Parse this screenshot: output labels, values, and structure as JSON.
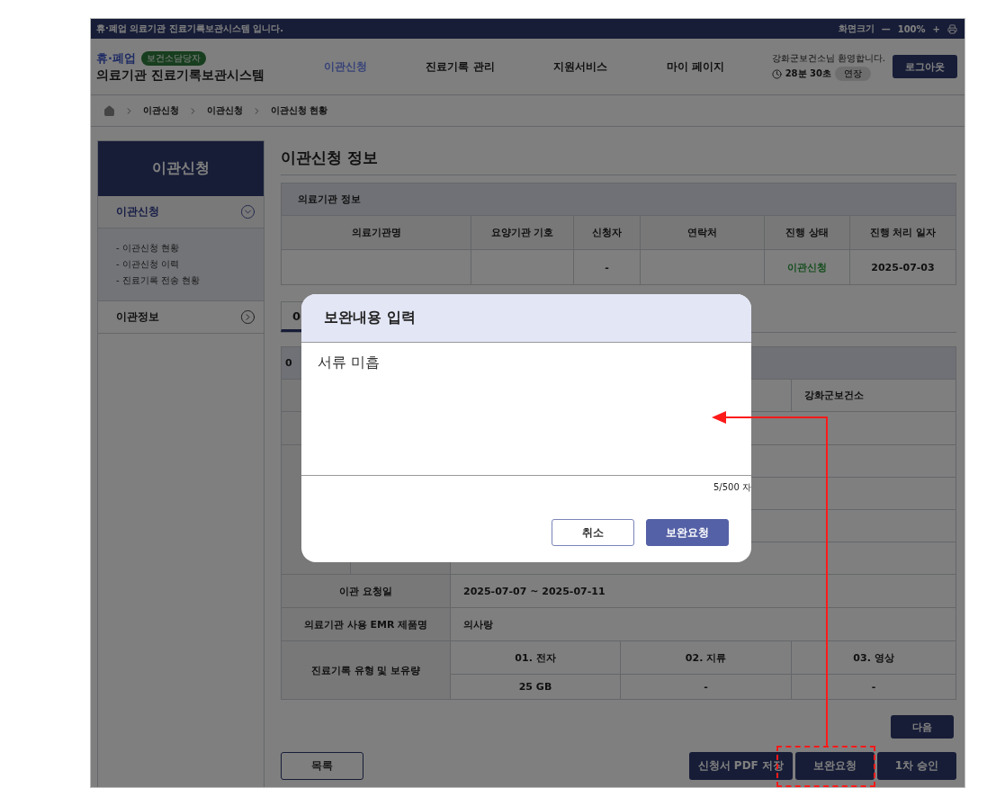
{
  "top_bar": {
    "notice": "휴·폐업 의료기관 진료기록보관시스템 입니다.",
    "zoom_label": "화면크기",
    "zoom_out": "—",
    "zoom_value": "100%",
    "zoom_in": "+"
  },
  "header": {
    "brand_tag": "휴·폐업",
    "role_badge": "보건소담당자",
    "system_name": "의료기관 진료기록보관시스템",
    "nav": [
      {
        "label": "이관신청",
        "selected": true
      },
      {
        "label": "진료기록 관리",
        "selected": false
      },
      {
        "label": "지원서비스",
        "selected": false
      },
      {
        "label": "마이 페이지",
        "selected": false
      }
    ],
    "welcome": "강화군보건소님 환영합니다.",
    "timer": "28분 30초",
    "extend_button": "연장",
    "logout_button": "로그아웃"
  },
  "breadcrumb": [
    "이관신청",
    "이관신청",
    "이관신청 현황"
  ],
  "sidebar": {
    "title": "이관신청",
    "items": [
      {
        "label": "이관신청",
        "expanded": true,
        "children": [
          {
            "label": "- 이관신청 현황"
          },
          {
            "label": "- 이관신청 이력"
          },
          {
            "label": "- 진료기록 전송 현황"
          }
        ]
      },
      {
        "label": "이관정보",
        "expanded": false
      }
    ]
  },
  "page_title": "이관신청 정보",
  "institution_info": {
    "title": "의료기관 정보",
    "columns": [
      "의료기관명",
      "요양기관 기호",
      "신청자",
      "연락처",
      "진행 상태",
      "진행 처리 일자"
    ],
    "applicant": "-",
    "status": "이관신청",
    "processed_date": "2025-07-03"
  },
  "tabs": [
    {
      "label": "0",
      "selected": true
    }
  ],
  "detail": {
    "section_title": "0",
    "health_center": "강화군보건소",
    "request_period_label": "이관 요청일",
    "request_period": "2025-07-07 ~ 2025-07-11",
    "emr_label": "의료기관 사용 EMR 제품명",
    "emr_value": "의사랑",
    "record_label": "진료기록 유형 및 보유량",
    "record_types": [
      {
        "type": "01. 전자",
        "amount": "25 GB"
      },
      {
        "type": "02. 지류",
        "amount": "-"
      },
      {
        "type": "03. 영상",
        "amount": "-"
      }
    ]
  },
  "next_button": "다음",
  "list_button": "목록",
  "action_buttons": [
    "신청서 PDF 저장",
    "보완요청",
    "1차 승인"
  ],
  "modal": {
    "title": "보완내용 입력",
    "value": "서류 미흡",
    "counter": "5/500 자",
    "cancel_button": "취소",
    "confirm_button": "보완요청"
  }
}
